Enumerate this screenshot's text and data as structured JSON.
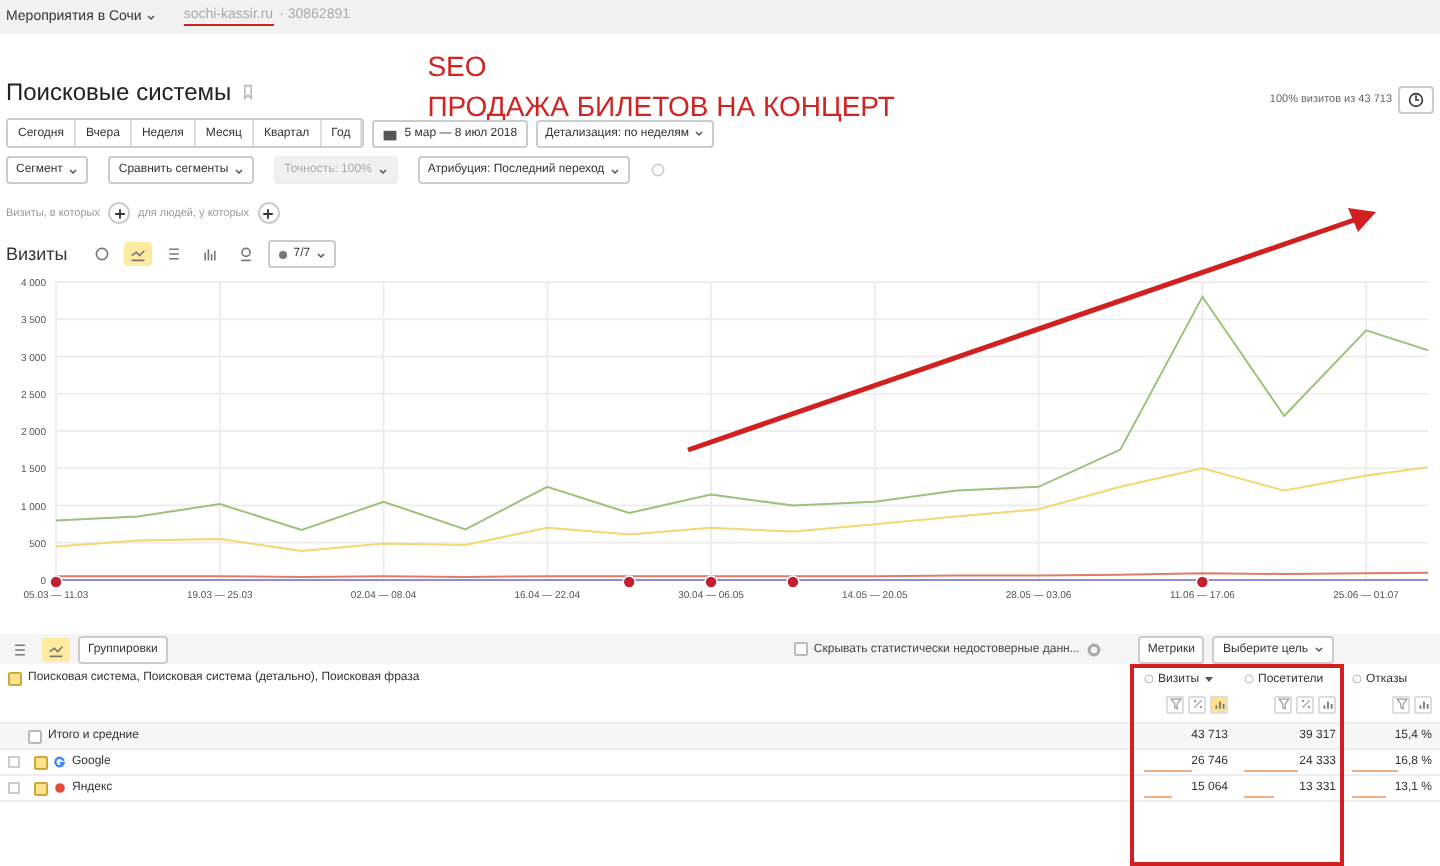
{
  "topbar": {
    "counter": "Мероприятия в Сочи",
    "site": "sochi-kassir.ru",
    "site_id": "· 30862891"
  },
  "annotation": {
    "lines": [
      "SEO",
      "ПРОДАЖА БИЛЕТОВ НА КОНЦЕРТ"
    ]
  },
  "report": {
    "title": "Поисковые системы",
    "sample": "100% визитов из 43 713"
  },
  "periods": [
    {
      "label": "Сегодня",
      "selected": false
    },
    {
      "label": "Вчера",
      "selected": false
    },
    {
      "label": "Неделя",
      "selected": false
    },
    {
      "label": "Месяц",
      "selected": false
    },
    {
      "label": "Квартал",
      "selected": false
    },
    {
      "label": "Год",
      "selected": false
    }
  ],
  "date_range": "5 мар — 8 июл 2018",
  "detail": "Детализация: по неделям",
  "filters": [
    {
      "label": "Сегмент",
      "disabled": false
    },
    {
      "label": "Сравнить сегменты",
      "disabled": false
    },
    {
      "label": "Точность: 100%",
      "disabled": true
    },
    {
      "label": "Атрибуция: Последний переход",
      "disabled": false
    }
  ],
  "conditions": [
    "Визиты, в которых",
    "для людей, у которых"
  ],
  "chart_header": {
    "metric": "Визиты",
    "views": [
      {
        "kind": "pie",
        "selected": false
      },
      {
        "kind": "line",
        "selected": true
      },
      {
        "kind": "stacked",
        "selected": false
      },
      {
        "kind": "bars",
        "selected": false
      },
      {
        "kind": "map",
        "selected": false
      }
    ],
    "series_count": "7/7"
  },
  "chart_data": {
    "type": "line",
    "grid": true,
    "categories": [
      "05.03 — 11.03",
      null,
      "19.03 — 25.03",
      null,
      "02.04 — 08.04",
      null,
      "16.04 — 22.04",
      null,
      "30.04 — 06.05",
      null,
      "14.05 — 20.05",
      null,
      "28.05 — 03.06",
      null,
      "11.06 — 17.06",
      null,
      "25.06 — 01.07",
      null
    ],
    "ylim": [
      0,
      4000
    ],
    "yticks": [
      {
        "value": 0,
        "label": "0"
      },
      {
        "value": 500,
        "label": "500"
      },
      {
        "value": 1000,
        "label": "1 000"
      },
      {
        "value": 1500,
        "label": "1 500"
      },
      {
        "value": 2000,
        "label": "2 000"
      },
      {
        "value": 2500,
        "label": "2 500"
      },
      {
        "value": 3000,
        "label": "3 000"
      },
      {
        "value": 3500,
        "label": "3 500"
      },
      {
        "value": 4000,
        "label": "4 000"
      }
    ],
    "series": [
      {
        "color": "#9bc27a",
        "values": [
          800,
          850,
          1020,
          670,
          1050,
          680,
          1250,
          900,
          1150,
          1000,
          1050,
          1200,
          1250,
          1750,
          3800,
          2200,
          3350,
          3000
        ]
      },
      {
        "color": "#f0d873",
        "values": [
          450,
          530,
          550,
          390,
          490,
          470,
          700,
          610,
          700,
          650,
          750,
          850,
          950,
          1250,
          1500,
          1200,
          1400,
          1550
        ]
      },
      {
        "color": "#e07b6b",
        "values": [
          50,
          50,
          50,
          40,
          50,
          40,
          50,
          50,
          50,
          50,
          50,
          60,
          60,
          70,
          90,
          80,
          90,
          100
        ]
      },
      {
        "color": "#8c8cd8",
        "values": [
          0,
          0,
          0,
          0,
          0,
          0,
          0,
          0,
          0,
          0,
          0,
          0,
          0,
          0,
          0,
          0,
          0,
          0
        ]
      }
    ]
  },
  "table_toolbar": {
    "groupings": "Группировки",
    "hide_unreliable": {
      "label": "Скрывать статистически недостоверные данн...",
      "checked": false
    },
    "metrics": "Метрики",
    "goal": "Выберите цель"
  },
  "table": {
    "dimensions": {
      "label": "Поисковая система, Поисковая система (детально), Поисковая фраза",
      "checked": true
    },
    "columns": [
      {
        "label": "Визиты",
        "sorted": true,
        "tools": [
          {
            "kind": "filter"
          },
          {
            "kind": "percent"
          },
          {
            "kind": "chart"
          }
        ],
        "chart_on": true
      },
      {
        "label": "Посетители",
        "tools": [
          {
            "kind": "filter"
          },
          {
            "kind": "percent"
          },
          {
            "kind": "chart"
          }
        ],
        "chart_on": false
      },
      {
        "label": "Отказы",
        "tools": [
          {
            "kind": "filter"
          },
          {
            "kind": "chart"
          }
        ],
        "chart_on": false
      }
    ],
    "rows": [
      {
        "kind": "total",
        "label": "Итого и средние",
        "checked": false,
        "cells": [
          "43 713",
          "39 317",
          "15,4 %"
        ]
      },
      {
        "kind": "google",
        "label": "Google",
        "checked": true,
        "cells": [
          "26 746",
          "24 333",
          "16,8 %"
        ],
        "bars": [
          {
            "level": 0.61
          },
          {
            "level": 0.62
          },
          {
            "level": 0.6
          }
        ]
      },
      {
        "kind": "yandex",
        "label": "Яндекс",
        "checked": true,
        "cells": [
          "15 064",
          "13 331",
          "13,1 %"
        ],
        "bars": [
          {
            "level": 0.34
          },
          {
            "level": 0.34
          },
          {
            "level": 0.45
          }
        ]
      }
    ]
  }
}
